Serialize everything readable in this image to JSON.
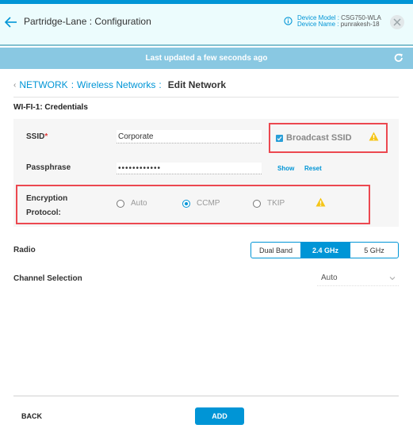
{
  "colors": {
    "accent": "#0095d6",
    "header_bg": "#ecfcfd",
    "update_bar_bg": "#89c8e2",
    "highlight_border": "#ec4850",
    "warning": "#f5c518",
    "panel_bg": "#f6f6f6"
  },
  "header": {
    "back_icon": "arrow-left-icon",
    "title": "Partridge-Lane : Configuration",
    "info_icon": "info-circle-icon",
    "device_model_label": "Device Model :",
    "device_model_value": "CSG750-WLA",
    "device_name_label": "Device Name :",
    "device_name_value": "punrakesh-18",
    "close_icon": "close-x-icon"
  },
  "status_bar": {
    "text": "Last updated a few seconds ago",
    "refresh_icon": "refresh-icon"
  },
  "breadcrumb": {
    "back_chevron": "‹",
    "items": [
      "NETWORK",
      "Wireless Networks"
    ],
    "separator": ":",
    "current": "Edit Network"
  },
  "section": {
    "title": "WI-FI-1: Credentials"
  },
  "credentials": {
    "ssid_label": "SSID",
    "ssid_required": "*",
    "ssid_value": "Corporate",
    "broadcast_ssid_label": "Broadcast SSID",
    "broadcast_ssid_checked": true,
    "passphrase_label": "Passphrase",
    "passphrase_value": "••••••••••••",
    "show_label": "Show",
    "reset_label": "Reset",
    "encryption_label_line1": "Encryption",
    "encryption_label_line2": "Protocol:",
    "encryption_options": [
      "Auto",
      "CCMP",
      "TKIP"
    ],
    "encryption_selected": "CCMP"
  },
  "radio": {
    "label": "Radio",
    "options": [
      "Dual Band",
      "2.4 GHz",
      "5 GHz"
    ],
    "selected": "2.4 GHz"
  },
  "channel": {
    "label": "Channel Selection",
    "value": "Auto"
  },
  "footer": {
    "back_label": "BACK",
    "add_label": "ADD"
  }
}
